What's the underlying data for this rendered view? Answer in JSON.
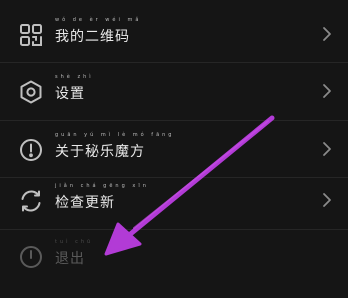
{
  "menu": {
    "items": [
      {
        "label": "我的二维码",
        "pinyin": "wǒ de èr wéi mǎ",
        "icon": "qr-code-icon"
      },
      {
        "label": "设置",
        "pinyin": "shè zhì",
        "icon": "settings-hexagon-icon"
      },
      {
        "label": "关于秘乐魔方",
        "pinyin": "guān yú mì lè mó fāng",
        "icon": "info-exclamation-icon"
      },
      {
        "label": "检查更新",
        "pinyin": "jiǎn chá gēng xīn",
        "icon": "refresh-icon"
      },
      {
        "label": "退出",
        "pinyin": "tuì chū",
        "icon": "power-icon"
      }
    ]
  },
  "colors": {
    "background": "#151515",
    "text": "#e9e9e9",
    "icon": "#bfbfbf",
    "disabled": "#5a5a5a",
    "annotation_arrow": "#b23bd6"
  }
}
